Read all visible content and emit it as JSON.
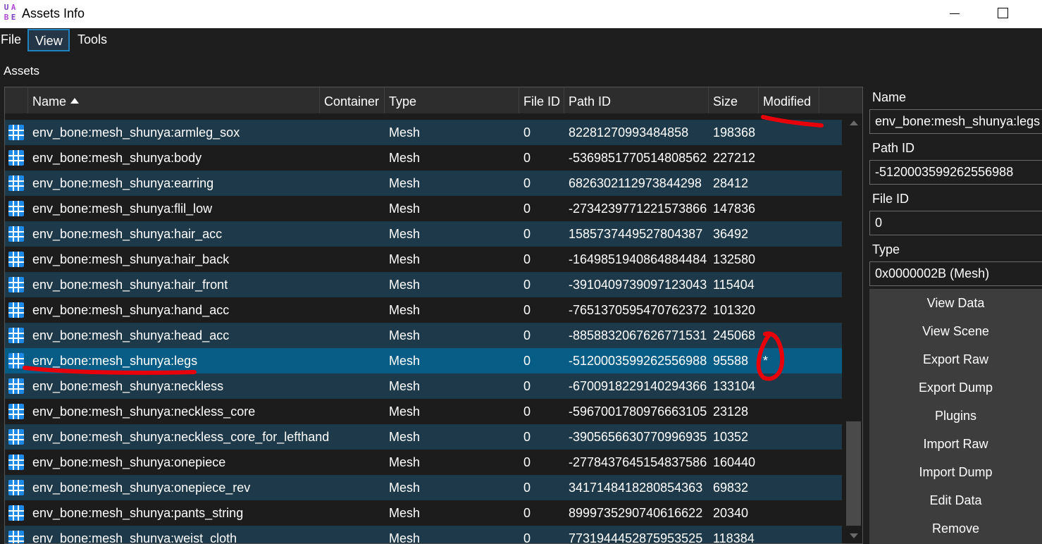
{
  "window": {
    "title": "Assets Info",
    "icon_letters": [
      "U",
      "A",
      "B",
      "E"
    ]
  },
  "menubar": {
    "items": [
      "File",
      "View",
      "Tools"
    ]
  },
  "assets_label": "Assets",
  "table": {
    "columns": [
      "Name",
      "Container",
      "Type",
      "File ID",
      "Path ID",
      "Size",
      "Modified"
    ],
    "sorted_column": "Name",
    "sort_direction": "ascending",
    "rows": [
      {
        "name": "env_bone:mesh_shunya:armleg_sox",
        "type": "Mesh",
        "file_id": "0",
        "path_id": "82281270993484858",
        "size": "198368",
        "modified": ""
      },
      {
        "name": "env_bone:mesh_shunya:body",
        "type": "Mesh",
        "file_id": "0",
        "path_id": "-5369851770514808562",
        "size": "227212",
        "modified": ""
      },
      {
        "name": "env_bone:mesh_shunya:earring",
        "type": "Mesh",
        "file_id": "0",
        "path_id": "6826302112973844298",
        "size": "28412",
        "modified": ""
      },
      {
        "name": "env_bone:mesh_shunya:flil_low",
        "type": "Mesh",
        "file_id": "0",
        "path_id": "-2734239771221573866",
        "size": "147836",
        "modified": ""
      },
      {
        "name": "env_bone:mesh_shunya:hair_acc",
        "type": "Mesh",
        "file_id": "0",
        "path_id": "1585737449527804387",
        "size": "36492",
        "modified": ""
      },
      {
        "name": "env_bone:mesh_shunya:hair_back",
        "type": "Mesh",
        "file_id": "0",
        "path_id": "-1649851940864884484",
        "size": "132580",
        "modified": ""
      },
      {
        "name": "env_bone:mesh_shunya:hair_front",
        "type": "Mesh",
        "file_id": "0",
        "path_id": "-3910409739097123043",
        "size": "115404",
        "modified": ""
      },
      {
        "name": "env_bone:mesh_shunya:hand_acc",
        "type": "Mesh",
        "file_id": "0",
        "path_id": "-7651370595470762372",
        "size": "101320",
        "modified": ""
      },
      {
        "name": "env_bone:mesh_shunya:head_acc",
        "type": "Mesh",
        "file_id": "0",
        "path_id": "-8858832067626771531",
        "size": "245068",
        "modified": ""
      },
      {
        "name": "env_bone:mesh_shunya:legs",
        "type": "Mesh",
        "file_id": "0",
        "path_id": "-5120003599262556988",
        "size": "95588",
        "modified": "*"
      },
      {
        "name": "env_bone:mesh_shunya:neckless",
        "type": "Mesh",
        "file_id": "0",
        "path_id": "-6700918229140294366",
        "size": "133104",
        "modified": ""
      },
      {
        "name": "env_bone:mesh_shunya:neckless_core",
        "type": "Mesh",
        "file_id": "0",
        "path_id": "-5967001780976663105",
        "size": "23128",
        "modified": ""
      },
      {
        "name": "env_bone:mesh_shunya:neckless_core_for_lefthand",
        "type": "Mesh",
        "file_id": "0",
        "path_id": "-3905656630770996935",
        "size": "10352",
        "modified": ""
      },
      {
        "name": "env_bone:mesh_shunya:onepiece",
        "type": "Mesh",
        "file_id": "0",
        "path_id": "-2778437645154837586",
        "size": "160440",
        "modified": ""
      },
      {
        "name": "env_bone:mesh_shunya:onepiece_rev",
        "type": "Mesh",
        "file_id": "0",
        "path_id": "3417148418280854363",
        "size": "69832",
        "modified": ""
      },
      {
        "name": "env_bone:mesh_shunya:pants_string",
        "type": "Mesh",
        "file_id": "0",
        "path_id": "8999735290740616622",
        "size": "20340",
        "modified": ""
      },
      {
        "name": "env_bone:mesh_shunya:weist_cloth",
        "type": "Mesh",
        "file_id": "0",
        "path_id": "7731944452875953525",
        "size": "118384",
        "modified": ""
      }
    ],
    "selected_index": 9
  },
  "details": {
    "name_label": "Name",
    "name_value": "env_bone:mesh_shunya:legs",
    "path_id_label": "Path ID",
    "path_id_value": "-5120003599262556988",
    "file_id_label": "File ID",
    "file_id_value": "0",
    "type_label": "Type",
    "type_value": "0x0000002B (Mesh)"
  },
  "actions": [
    "View Data",
    "View Scene",
    "Export Raw",
    "Export Dump",
    "Plugins",
    "Import Raw",
    "Import Dump",
    "Edit Data",
    "Remove"
  ],
  "colors": {
    "row_alt": "#1e3a4a",
    "row_selected": "#085d86",
    "menu_active_border": "#1f84c1",
    "annotation_red": "#e8000b",
    "mesh_icon": "#1e88e5"
  }
}
